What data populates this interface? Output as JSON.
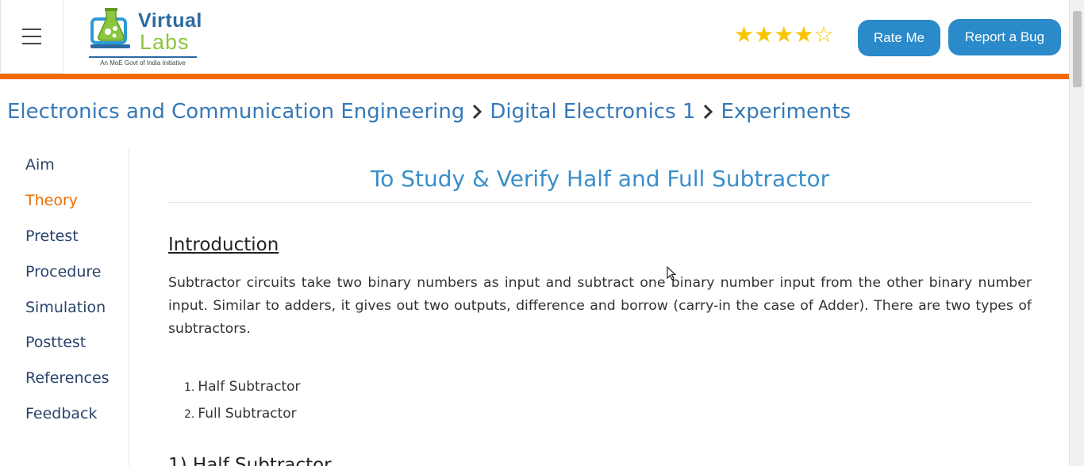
{
  "header": {
    "logo_line1": "Virtual",
    "logo_line2": "Labs",
    "logo_tagline": "An MoE Govt of India Initiative",
    "rating": {
      "filled": 4,
      "total": 5
    },
    "rate_button": "Rate Me",
    "bug_button": "Report a Bug"
  },
  "breadcrumb": [
    "Electronics and Communication Engineering",
    "Digital Electronics 1",
    "Experiments"
  ],
  "sidebar": {
    "items": [
      {
        "label": "Aim"
      },
      {
        "label": "Theory",
        "active": true
      },
      {
        "label": "Pretest"
      },
      {
        "label": "Procedure"
      },
      {
        "label": "Simulation"
      },
      {
        "label": "Posttest"
      },
      {
        "label": "References"
      },
      {
        "label": "Feedback"
      }
    ]
  },
  "content": {
    "title": "To Study & Verify Half and Full Subtractor",
    "intro_heading": "Introduction",
    "intro_text": "Subtractor circuits take two binary numbers as input and subtract one binary number input from the other binary number input. Similar to adders, it gives out two outputs, difference and borrow (carry-in the case of Adder). There are two types of subtractors.",
    "types": [
      "Half Subtractor",
      "Full Subtractor"
    ],
    "next_heading": "1) Half Subtractor"
  },
  "colors": {
    "accent_orange": "#ef6b00",
    "button_blue": "#2b8ac9",
    "link_blue": "#3579b8",
    "title_blue": "#3a8fc9",
    "star_gold": "#f7c600"
  }
}
